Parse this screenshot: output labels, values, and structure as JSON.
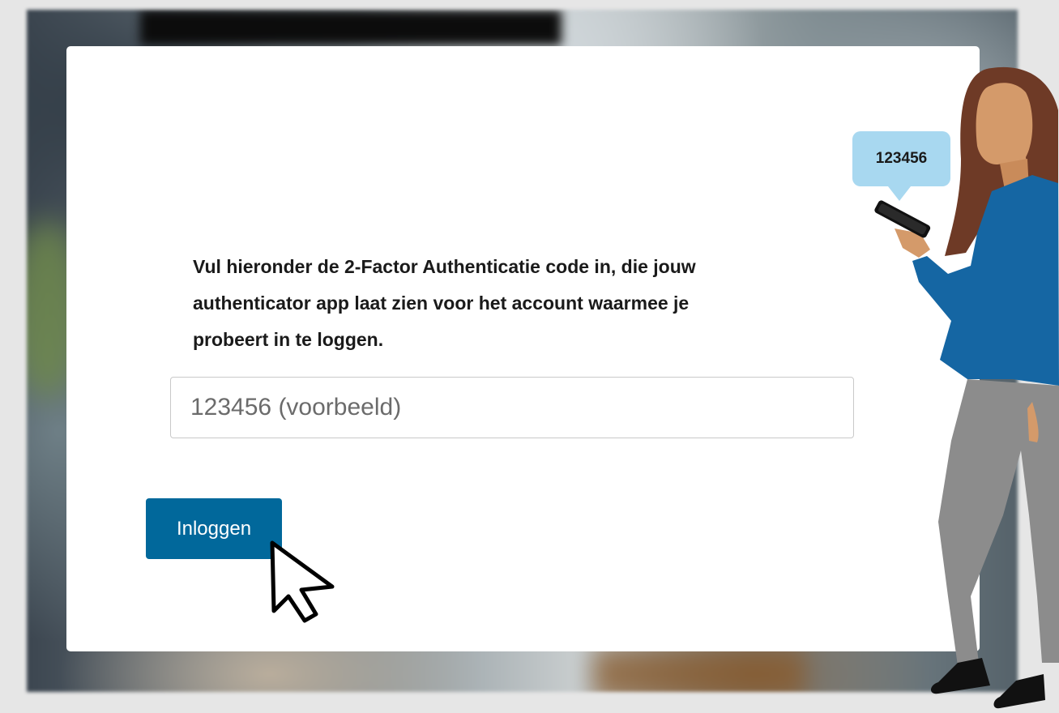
{
  "form": {
    "instruction": "Vul hieronder de 2-Factor Authenticatie code in, die jouw authenticator app laat zien voor het account waarmee je probeert in te loggen.",
    "code_placeholder": "123456 (voorbeeld)",
    "code_value": "",
    "login_label": "Inloggen"
  },
  "illustration": {
    "bubble_code": "123456",
    "icons": [
      "mouse-pointer-icon",
      "smartphone-icon"
    ]
  },
  "colors": {
    "button": "#01689b",
    "bubble": "#a8d8f0",
    "shirt": "#1566a3",
    "pants": "#8c8c8c",
    "hair": "#6e3a26",
    "skin": "#d49a6a"
  }
}
